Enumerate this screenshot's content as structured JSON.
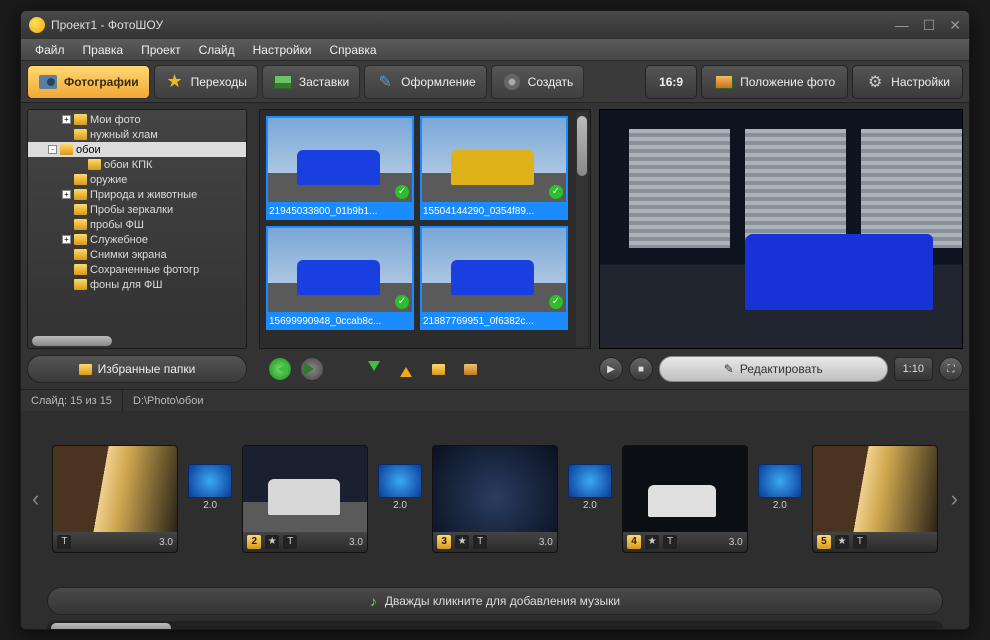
{
  "window": {
    "title": "Проект1 - ФотоШОУ"
  },
  "menu": [
    "Файл",
    "Правка",
    "Проект",
    "Слайд",
    "Настройки",
    "Справка"
  ],
  "tabs": {
    "photos": "Фотографии",
    "transitions": "Переходы",
    "splash": "Заставки",
    "design": "Оформление",
    "create": "Создать"
  },
  "right_bar": {
    "aspect": "16:9",
    "position": "Положение фото",
    "settings": "Настройки"
  },
  "tree": {
    "rows": [
      {
        "indent": 2,
        "exp": "+",
        "label": "Мои фото"
      },
      {
        "indent": 2,
        "exp": "",
        "label": "нужный хлам"
      },
      {
        "indent": 1,
        "exp": "-",
        "label": "обои",
        "sel": true
      },
      {
        "indent": 3,
        "exp": "",
        "label": "обои КПК"
      },
      {
        "indent": 2,
        "exp": "",
        "label": "оружие"
      },
      {
        "indent": 2,
        "exp": "+",
        "label": "Природа и животные"
      },
      {
        "indent": 2,
        "exp": "",
        "label": "Пробы зеркалки"
      },
      {
        "indent": 2,
        "exp": "",
        "label": "пробы ФШ"
      },
      {
        "indent": 2,
        "exp": "+",
        "label": "Служебное"
      },
      {
        "indent": 2,
        "exp": "",
        "label": "Снимки экрана"
      },
      {
        "indent": 2,
        "exp": "",
        "label": "Сохраненные фотогр"
      },
      {
        "indent": 2,
        "exp": "",
        "label": "фоны для ФШ"
      }
    ],
    "fav": "Избранные папки"
  },
  "thumbs": [
    {
      "name": "21945033800_01b9b1...",
      "car": "blue"
    },
    {
      "name": "15504144290_0354f89...",
      "car": "yellow"
    },
    {
      "name": "15699990948_0ccab8c...",
      "car": "blue"
    },
    {
      "name": "21887769951_0f6382c...",
      "car": "blue"
    }
  ],
  "preview": {
    "edit": "Редактировать",
    "time": "1:10"
  },
  "status": {
    "slide": "Слайд: 15 из 15",
    "path": "D:\\Photo\\обои"
  },
  "timeline": {
    "slides": [
      {
        "num": "",
        "dur": "3.0",
        "scene": "A"
      },
      {
        "num": "2",
        "dur": "3.0",
        "scene": "carW"
      },
      {
        "num": "3",
        "dur": "3.0",
        "scene": "B"
      },
      {
        "num": "4",
        "dur": "3.0",
        "scene": "C"
      },
      {
        "num": "5",
        "dur": "",
        "scene": "A"
      }
    ],
    "trans_dur": "2.0",
    "music": "Дважды кликните для добавления музыки"
  }
}
